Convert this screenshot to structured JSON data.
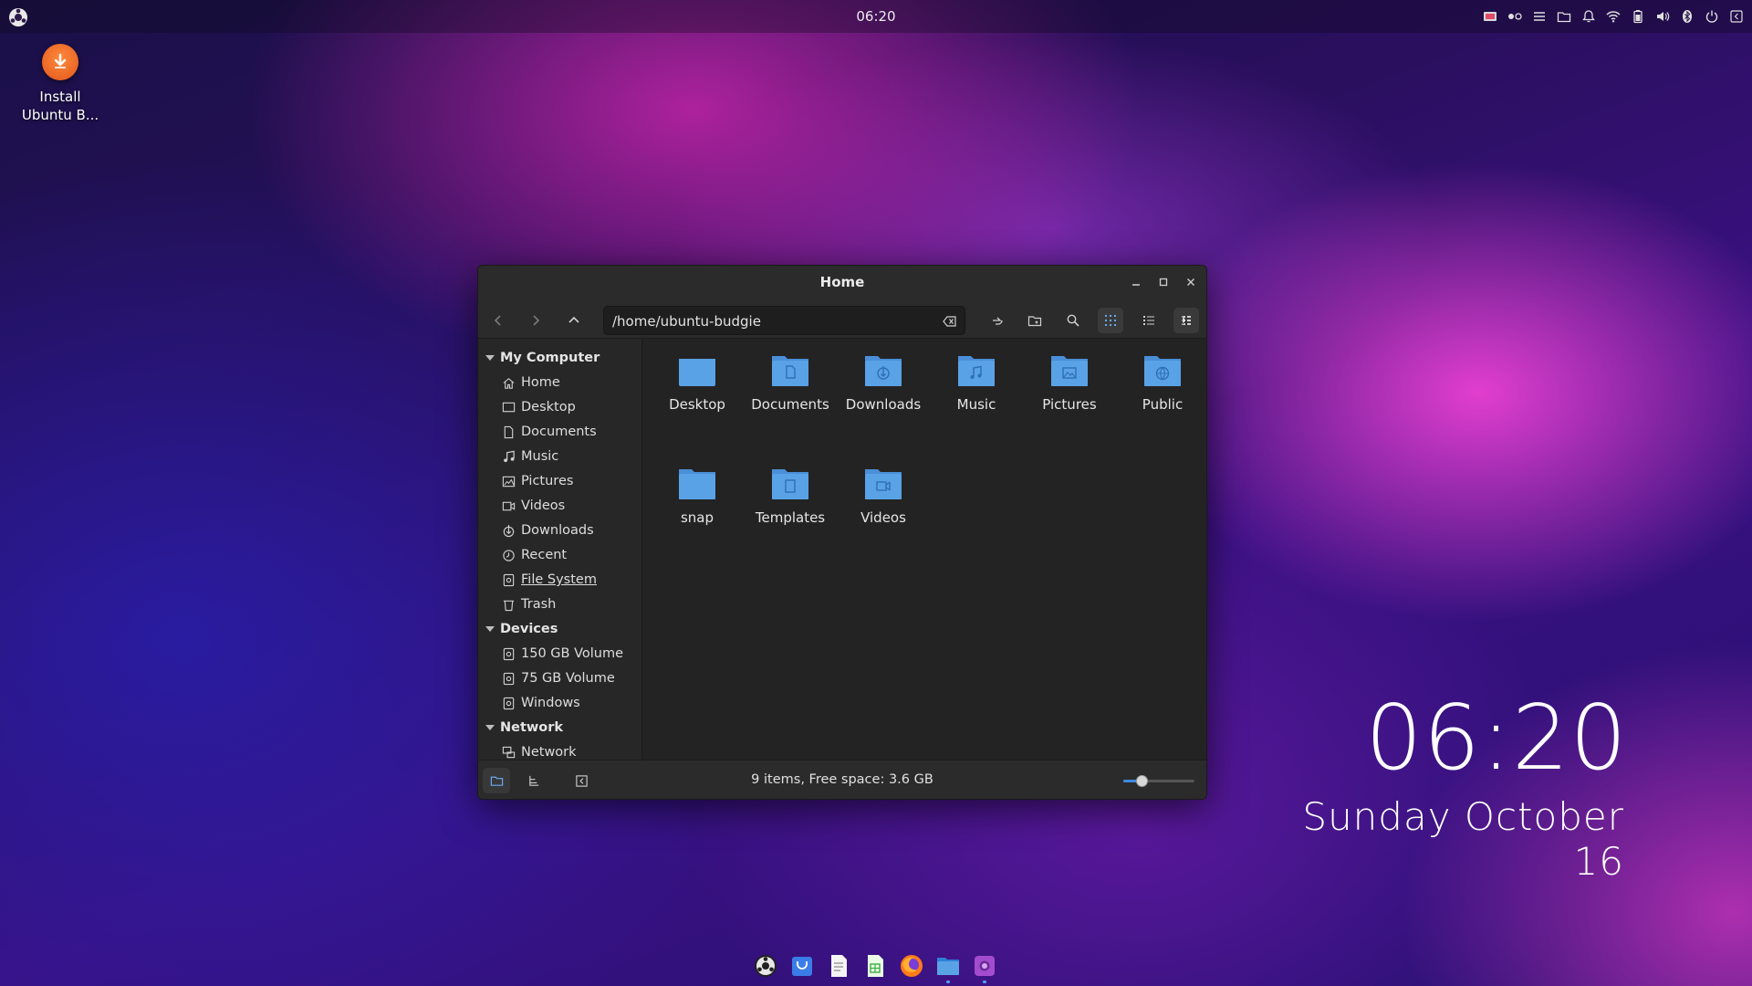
{
  "top_panel": {
    "clock": "06:20"
  },
  "desktop": {
    "install_icon_label": "Install Ubuntu B...",
    "big_time": "06:20",
    "big_date": "Sunday October 16"
  },
  "window": {
    "title": "Home",
    "path": "/home/ubuntu-budgie",
    "status": "9 items, Free space: 3.6 GB",
    "zoom_level": 0.25
  },
  "sidebar": {
    "sections": [
      {
        "title": "My Computer",
        "items": [
          {
            "label": "Home",
            "icon": "home-icon"
          },
          {
            "label": "Desktop",
            "icon": "desktop-icon"
          },
          {
            "label": "Documents",
            "icon": "document-icon"
          },
          {
            "label": "Music",
            "icon": "music-icon"
          },
          {
            "label": "Pictures",
            "icon": "picture-icon"
          },
          {
            "label": "Videos",
            "icon": "video-icon"
          },
          {
            "label": "Downloads",
            "icon": "download-icon"
          },
          {
            "label": "Recent",
            "icon": "clock-icon"
          },
          {
            "label": "File System",
            "icon": "drive-icon"
          },
          {
            "label": "Trash",
            "icon": "trash-icon"
          }
        ]
      },
      {
        "title": "Devices",
        "items": [
          {
            "label": "150 GB Volume",
            "icon": "drive-icon"
          },
          {
            "label": "75 GB Volume",
            "icon": "drive-icon"
          },
          {
            "label": "Windows",
            "icon": "drive-icon"
          }
        ]
      },
      {
        "title": "Network",
        "items": [
          {
            "label": "Network",
            "icon": "network-icon"
          }
        ]
      }
    ]
  },
  "files": [
    {
      "name": "Desktop",
      "icon": "folder-desktop-icon"
    },
    {
      "name": "Documents",
      "icon": "folder-documents-icon"
    },
    {
      "name": "Downloads",
      "icon": "folder-download-icon"
    },
    {
      "name": "Music",
      "icon": "folder-music-icon"
    },
    {
      "name": "Pictures",
      "icon": "folder-pictures-icon"
    },
    {
      "name": "Public",
      "icon": "folder-public-icon"
    },
    {
      "name": "snap",
      "icon": "folder-icon"
    },
    {
      "name": "Templates",
      "icon": "folder-templates-icon"
    },
    {
      "name": "Videos",
      "icon": "folder-videos-icon"
    }
  ],
  "colors": {
    "folder": "#5aa2e6",
    "accent": "#3f8ae0",
    "window_bg": "#242424"
  }
}
